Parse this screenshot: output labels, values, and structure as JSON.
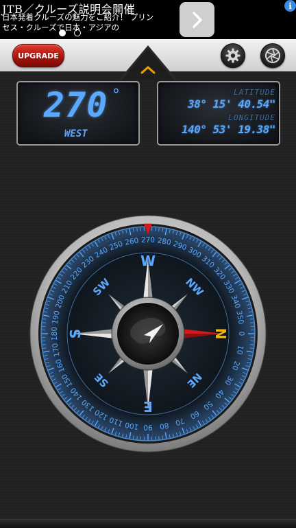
{
  "ad": {
    "title": "JTB／クルーズ説明会開催",
    "body": "日本発着クルーズの魅力をご紹介！ プリンセス・クルーズで日本・アジアの",
    "info_label": "i",
    "page_index": 1,
    "page_count": 2
  },
  "toolbar": {
    "upgrade_label": "UPGRADE",
    "settings_icon": "gear-icon",
    "camera_icon": "aperture-icon",
    "expand_icon": "chevron-up-icon"
  },
  "heading": {
    "degrees": "270",
    "degree_symbol": "°",
    "direction": "WEST"
  },
  "coords": {
    "latitude_label": "LATITUDE",
    "latitude_value": "38° 15' 40.54\"",
    "longitude_label": "LONGITUDE",
    "longitude_value": "140° 53' 19.38\""
  },
  "compass": {
    "heading": 270,
    "cardinals": {
      "N": "N",
      "E": "E",
      "S": "S",
      "W": "W"
    },
    "intercardinals": {
      "NW": "NW",
      "NE": "NE",
      "SW": "SW",
      "SE": "SE"
    },
    "dial_labels": [
      "0",
      "10",
      "20",
      "30",
      "40",
      "50",
      "60",
      "70",
      "80",
      "90",
      "100",
      "110",
      "120",
      "130",
      "140",
      "150",
      "160",
      "170",
      "180",
      "190",
      "200",
      "210",
      "220",
      "230",
      "240",
      "250",
      "260",
      "270",
      "280",
      "290",
      "300",
      "310",
      "320",
      "330",
      "340",
      "350"
    ],
    "colors": {
      "accent": "#5aa9ff",
      "north": "#d61a1a",
      "n_letter": "#f0b400"
    }
  }
}
